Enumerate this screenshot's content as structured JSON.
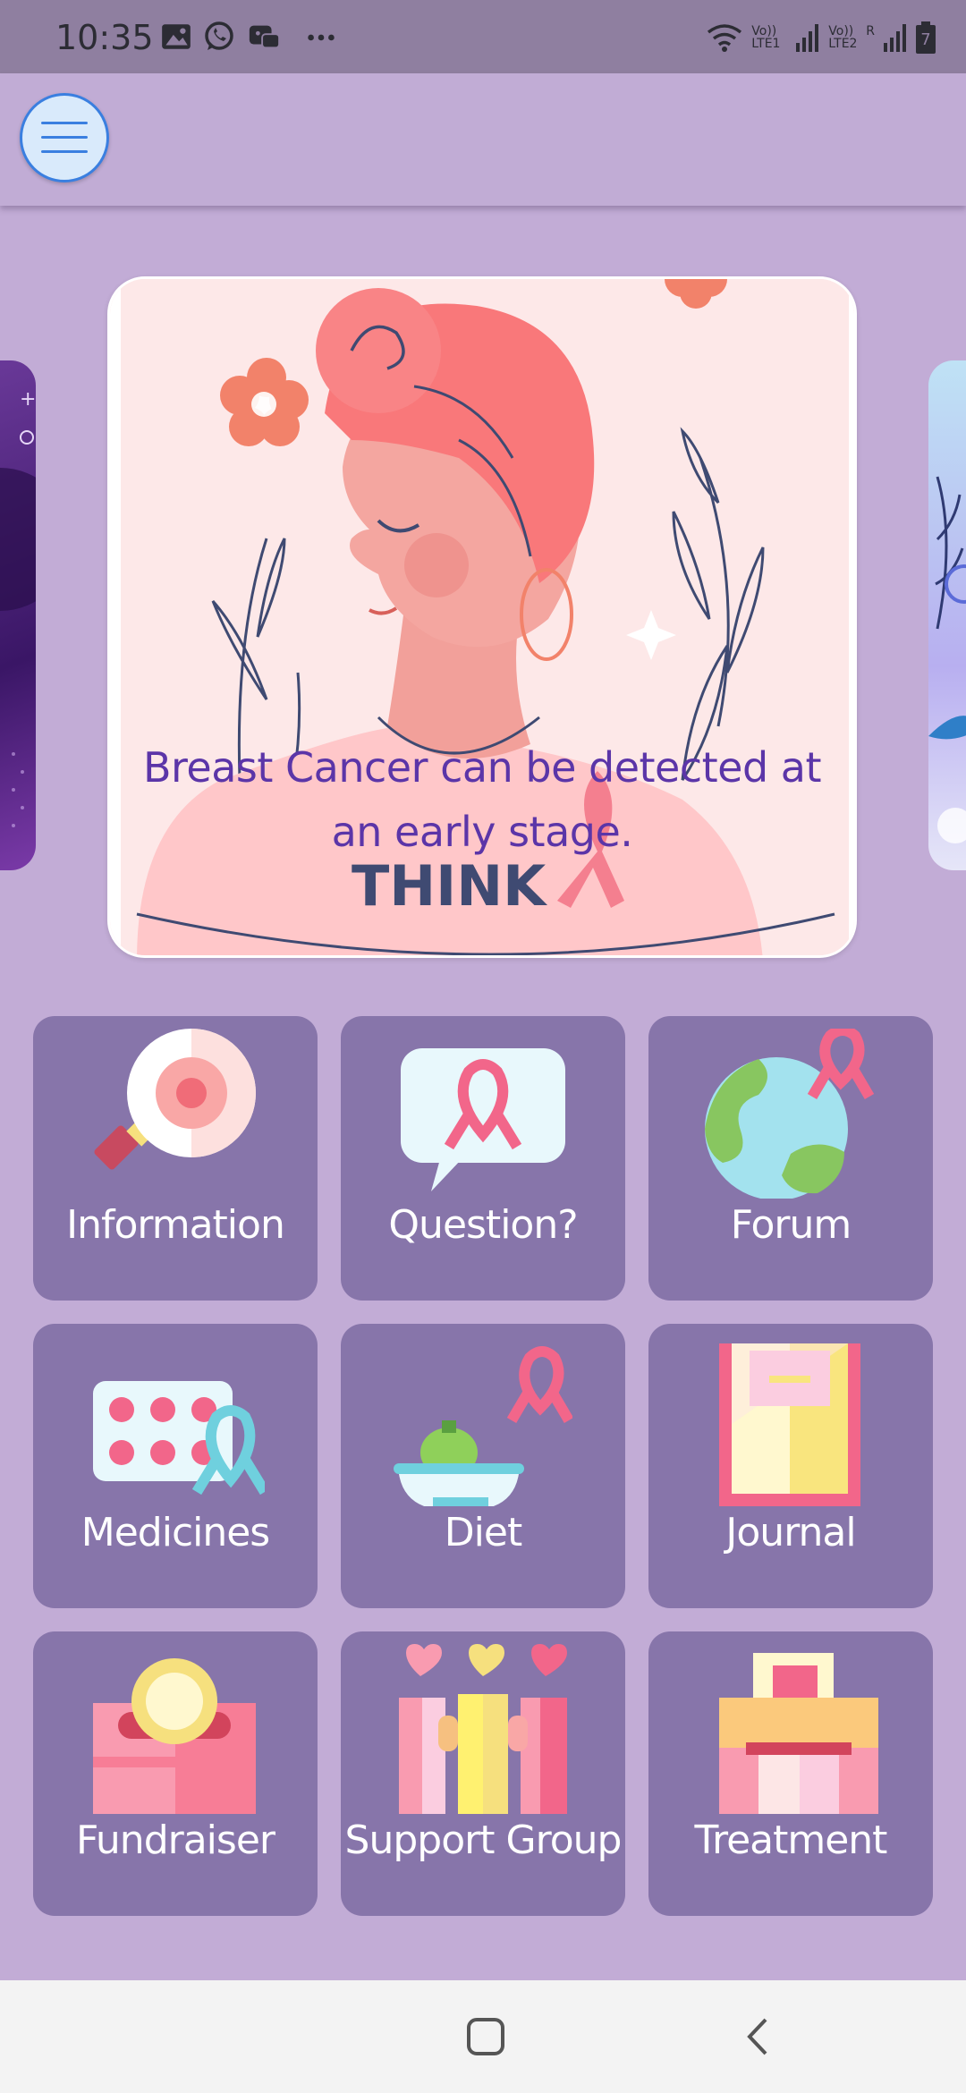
{
  "status_bar": {
    "time": "10:35",
    "notification_icons": [
      "image-icon",
      "whatsapp-icon",
      "game-controller-icon",
      "more-dots-icon"
    ],
    "right_icons": [
      "wifi-icon",
      "signal-sim1-icon",
      "signal-sim2-icon",
      "battery-icon"
    ],
    "sim1_label": "Vo)) LTE1",
    "sim2_label": "Vo)) LTE2",
    "roaming": "R",
    "battery_level": "7"
  },
  "app_bar": {
    "menu_icon": "hamburger-menu-icon"
  },
  "carousel": {
    "caption_line1": "Breast Cancer can be detected at",
    "caption_line2": "an early stage.",
    "artwork_text": "THINK"
  },
  "tiles": [
    {
      "label": "Information",
      "icon": "magnifier-icon"
    },
    {
      "label": "Question?",
      "icon": "speech-bubble-ribbon-icon"
    },
    {
      "label": "Forum",
      "icon": "globe-ribbon-icon"
    },
    {
      "label": "Medicines",
      "icon": "pill-pack-icon"
    },
    {
      "label": "Diet",
      "icon": "food-bowl-icon"
    },
    {
      "label": "Journal",
      "icon": "notebook-icon"
    },
    {
      "label": "Fundraiser",
      "icon": "donation-box-icon"
    },
    {
      "label": "Support Group",
      "icon": "people-hearts-icon"
    },
    {
      "label": "Treatment",
      "icon": "hospital-icon"
    }
  ],
  "colors": {
    "background": "#c2acd6",
    "tile": "#8775aa",
    "caption": "#5b35a8",
    "status_bar": "#8f7fa0"
  },
  "nav_bar": {
    "home_icon": "home-square-icon",
    "back_icon": "back-chevron-icon"
  }
}
